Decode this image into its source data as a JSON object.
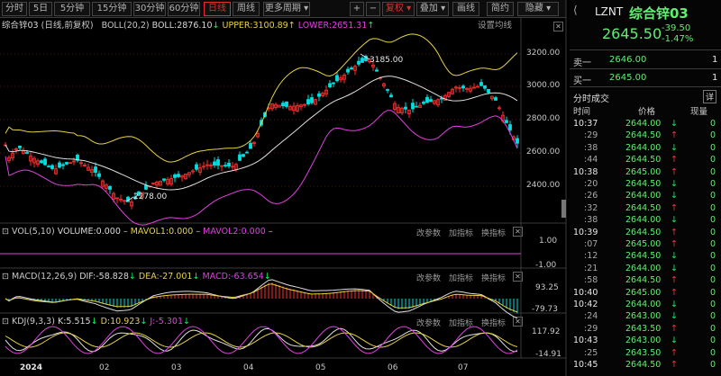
{
  "toolbar": {
    "items": [
      "分时",
      "5日",
      "5分钟",
      "15分钟",
      "30分钟",
      "60分钟",
      "日线",
      "周线",
      "更多周期 ▾"
    ],
    "plus": "+",
    "minus": "−",
    "fuquan": "复权",
    "diejia": "叠加",
    "huaxian": "画线",
    "jianyue": "简约",
    "yincang": "隐藏"
  },
  "main": {
    "title": "综合锌03",
    "subtitle": "(日线,前复权)",
    "indicator": "BOLL(20,2)",
    "boll": "BOLL:2876.10",
    "upper": "UPPER:3100.89",
    "lower": "LOWER:2651.31",
    "setting": "设置均线",
    "yticks": [
      "3200.00",
      "3000.00",
      "2800.00",
      "2600.00",
      "2400.00"
    ],
    "high": "3185.00",
    "low": "2278.00"
  },
  "vol": {
    "label": "VOL(5,10)",
    "volume": "VOLUME:0.000",
    "mavol1": "MAVOL1:0.000",
    "mavol2": "MAVOL2:0.000",
    "yticks": [
      "1.00",
      "-1.00"
    ]
  },
  "macd": {
    "label": "MACD(12,26,9)",
    "dif": "DIF:-58.828",
    "dea": "DEA:-27.001",
    "macd": "MACD:-63.654",
    "yticks": [
      "93.25",
      "-79.73"
    ]
  },
  "kdj": {
    "label": "KDJ(9,3,3)",
    "k": "K:5.515",
    "d": "D:10.923",
    "j": "J:-5.301",
    "yticks": [
      "117.92",
      "-14.91"
    ]
  },
  "panel_buttons": {
    "params": "改参数",
    "add": "加指标",
    "switch": "换指标",
    "close": "✕"
  },
  "xaxis": {
    "labels": [
      "2024",
      "02",
      "03",
      "04",
      "05",
      "06",
      "07"
    ]
  },
  "quote": {
    "code": "LZNT",
    "name": "综合锌03",
    "price": "2645.50",
    "change": "-39.50",
    "pct": "-1.47%",
    "sell_label": "卖一",
    "sell_price": "2646.00",
    "sell_vol": "1",
    "buy_label": "买一",
    "buy_price": "2645.00",
    "buy_vol": "1",
    "trades_title": "分时成交",
    "detail": "详",
    "col_time": "时间",
    "col_price": "价格",
    "col_vol": "现量"
  },
  "ticks": [
    {
      "t": "10:37",
      "p": "2644.00",
      "d": "down",
      "v": "0"
    },
    {
      "t": ":29",
      "p": "2644.50",
      "d": "up",
      "v": "0"
    },
    {
      "t": ":38",
      "p": "2644.00",
      "d": "down",
      "v": "0"
    },
    {
      "t": ":44",
      "p": "2644.50",
      "d": "up",
      "v": "0"
    },
    {
      "t": "10:38",
      "p": "2645.00",
      "d": "up",
      "v": "0"
    },
    {
      "t": ":20",
      "p": "2644.50",
      "d": "down",
      "v": "0"
    },
    {
      "t": ":26",
      "p": "2644.00",
      "d": "down",
      "v": "0"
    },
    {
      "t": ":32",
      "p": "2644.50",
      "d": "up",
      "v": "0"
    },
    {
      "t": ":38",
      "p": "2644.00",
      "d": "down",
      "v": "0"
    },
    {
      "t": "10:39",
      "p": "2644.50",
      "d": "up",
      "v": "0"
    },
    {
      "t": ":07",
      "p": "2645.00",
      "d": "up",
      "v": "0"
    },
    {
      "t": ":12",
      "p": "2644.50",
      "d": "down",
      "v": "0"
    },
    {
      "t": ":21",
      "p": "2644.00",
      "d": "down",
      "v": "0"
    },
    {
      "t": ":58",
      "p": "2644.50",
      "d": "up",
      "v": "0"
    },
    {
      "t": "10:40",
      "p": "2645.00",
      "d": "up",
      "v": "0"
    },
    {
      "t": "10:42",
      "p": "2644.00",
      "d": "down",
      "v": "0"
    },
    {
      "t": ":24",
      "p": "2643.00",
      "d": "down",
      "v": "0"
    },
    {
      "t": ":29",
      "p": "2643.50",
      "d": "up",
      "v": "0"
    },
    {
      "t": "10:43",
      "p": "2643.00",
      "d": "down",
      "v": "0"
    },
    {
      "t": ":25",
      "p": "2643.50",
      "d": "up",
      "v": "0"
    },
    {
      "t": "10:45",
      "p": "2644.50",
      "d": "up",
      "v": "0"
    }
  ],
  "colors": {
    "up": "#ff3030",
    "down": "#00e0e0",
    "green": "#00ff60",
    "yellow": "#e6d240",
    "magenta": "#e040e0"
  }
}
